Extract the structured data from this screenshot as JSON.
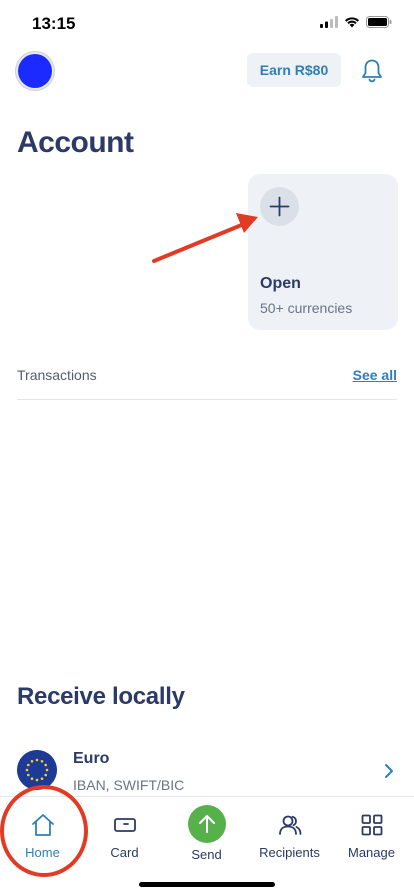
{
  "status_bar": {
    "time": "13:15"
  },
  "header": {
    "earn_label": "Earn R$80"
  },
  "page_title": "Account",
  "open_card": {
    "title": "Open",
    "subtitle": "50+ currencies"
  },
  "transactions": {
    "label": "Transactions",
    "see_all": "See all"
  },
  "receive": {
    "title": "Receive locally",
    "items": [
      {
        "name": "Euro",
        "detail": "IBAN, SWIFT/BIC"
      }
    ]
  },
  "nav": {
    "items": [
      {
        "label": "Home",
        "icon": "home-icon",
        "active": true
      },
      {
        "label": "Card",
        "icon": "card-icon"
      },
      {
        "label": "Send",
        "icon": "send-arrow-icon"
      },
      {
        "label": "Recipients",
        "icon": "recipients-icon"
      },
      {
        "label": "Manage",
        "icon": "grid-icon"
      }
    ]
  },
  "colors": {
    "accent": "#2e7fb8",
    "title": "#2b3a66",
    "send_green": "#58b04d",
    "annotation_red": "#e23b25",
    "avatar_blue": "#1b2bff"
  }
}
